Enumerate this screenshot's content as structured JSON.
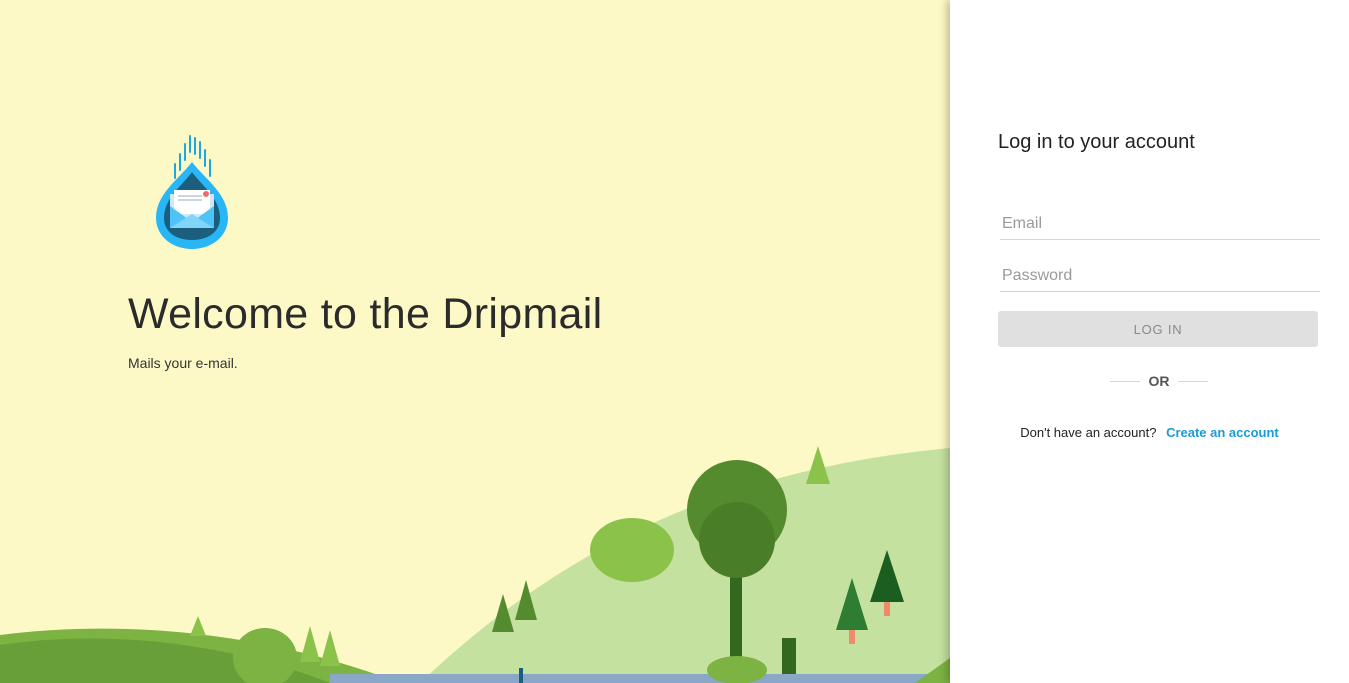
{
  "welcome": {
    "title": "Welcome to the Dripmail",
    "tagline": "Mails your e-mail."
  },
  "login": {
    "title": "Log in to your account",
    "email_placeholder": "Email",
    "password_placeholder": "Password",
    "button_label": "LOG IN",
    "divider_label": "OR",
    "signup_prompt": "Don't have an account?",
    "signup_link": "Create an account"
  },
  "colors": {
    "left_background": "#fcf9c6",
    "accent_link": "#1a9ad6",
    "button_disabled": "#e0e0e0",
    "logo_blue": "#29b6f6"
  },
  "icons": {
    "logo": "dripmail-drop-envelope-icon"
  }
}
